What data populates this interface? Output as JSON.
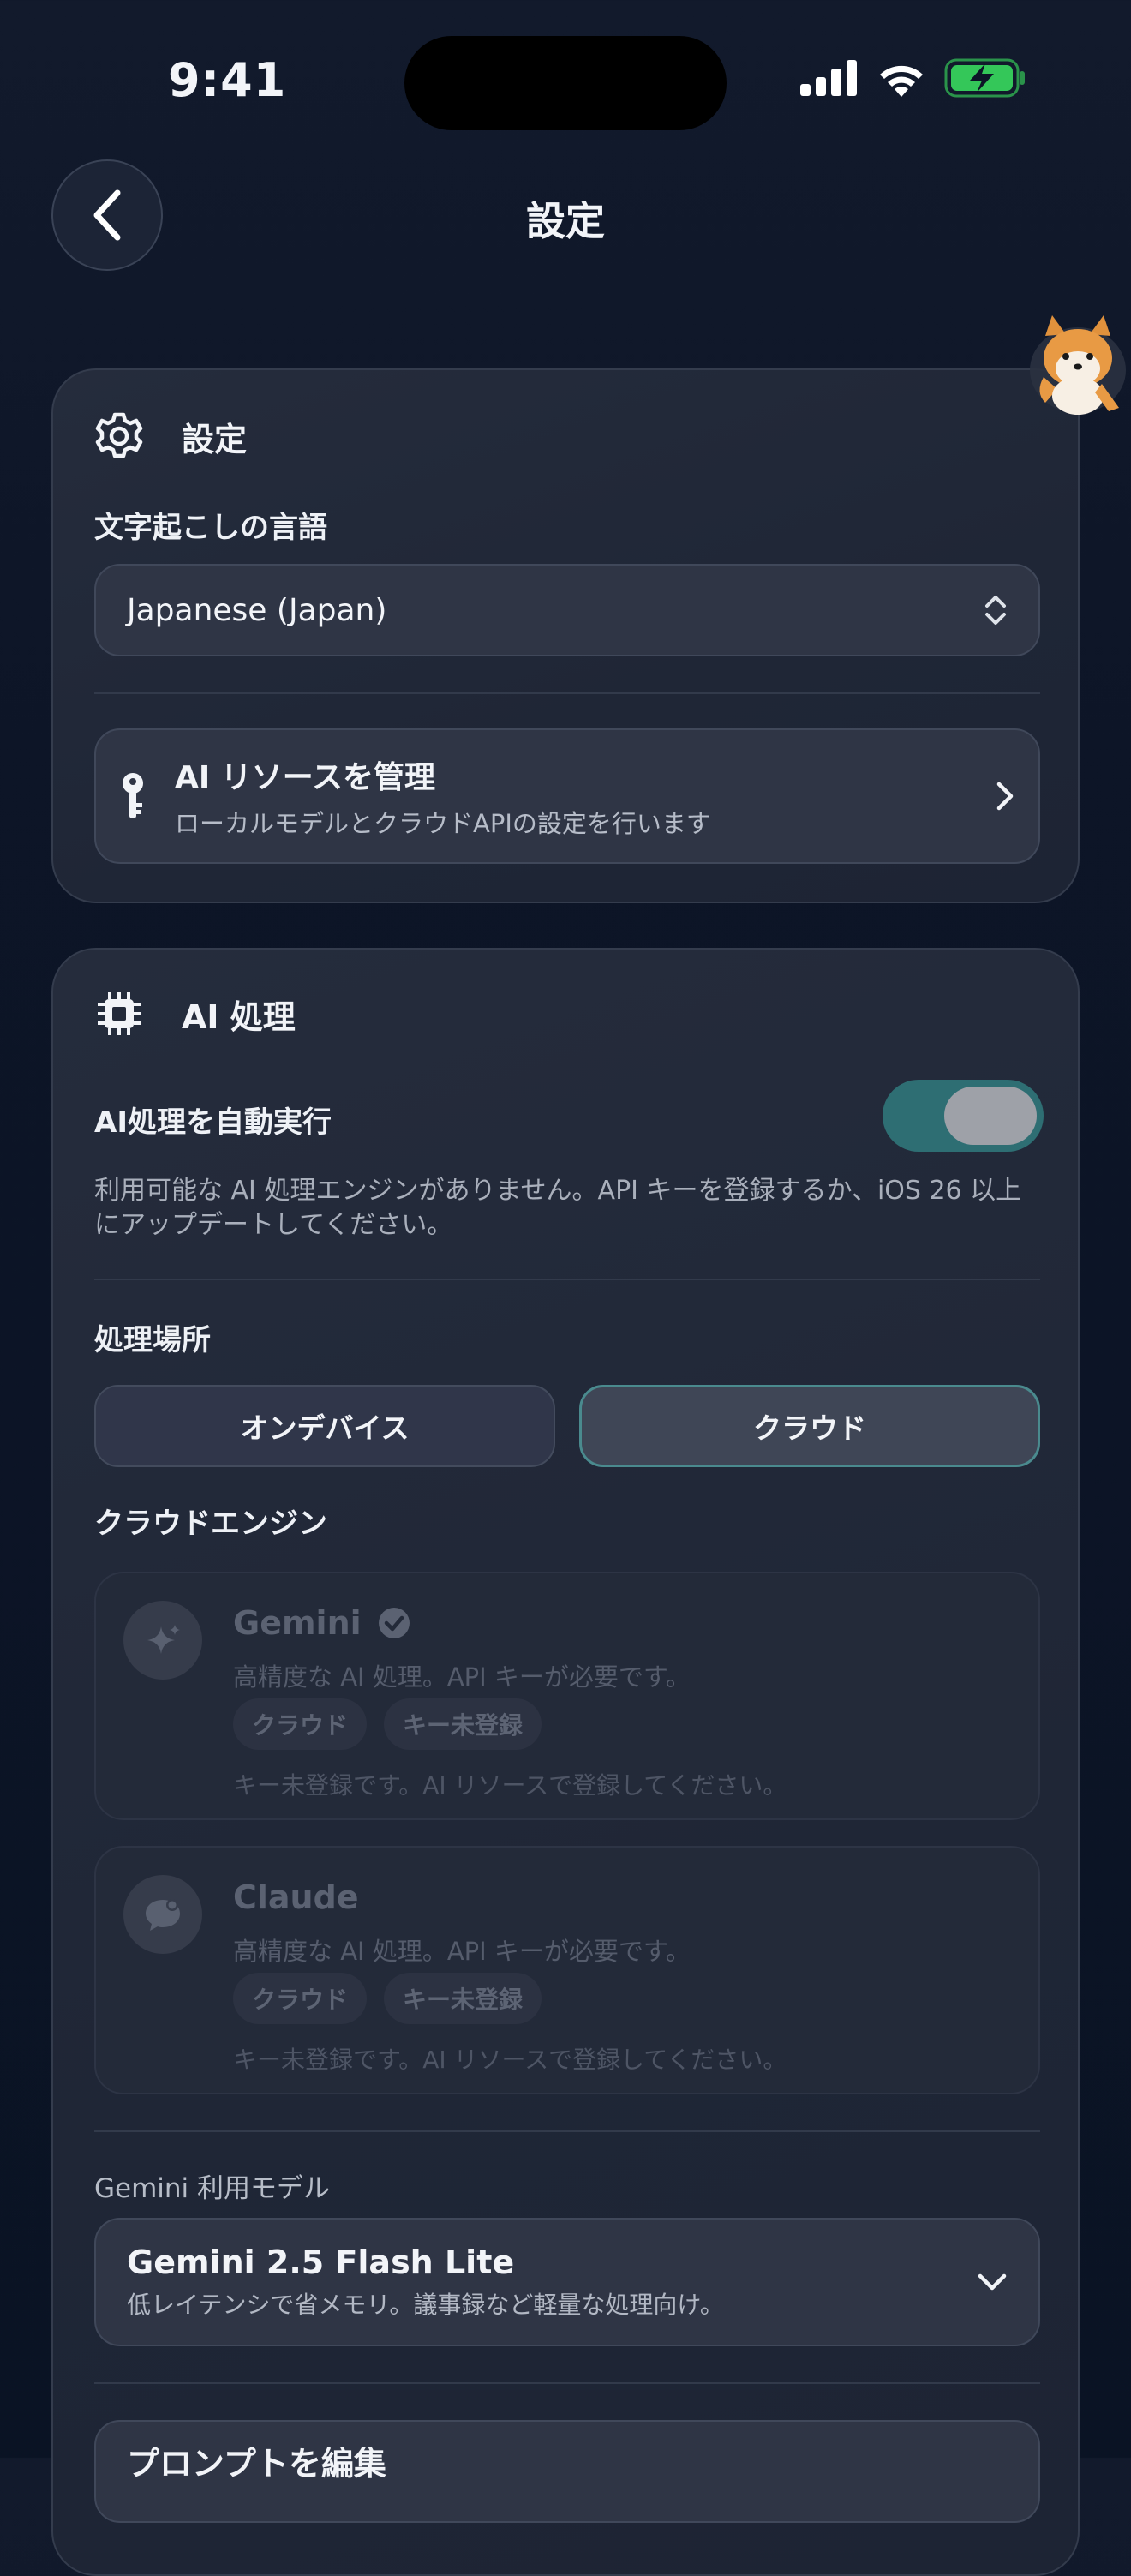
{
  "status": {
    "time": "9:41"
  },
  "nav": {
    "title": "設定"
  },
  "settings_card": {
    "header": "設定",
    "language_label": "文字起こしの言語",
    "language_value": "Japanese (Japan)",
    "ai_resources_title": "AI リソースを管理",
    "ai_resources_subtitle": "ローカルモデルとクラウドAPIの設定を行います"
  },
  "ai_card": {
    "header": "AI 処理",
    "auto_run_label": "AI処理を自動実行",
    "auto_run_enabled": true,
    "description": "利用可能な AI 処理エンジンがありません。API キーを登録するか、iOS 26 以上にアップデートしてください。",
    "location_label": "処理場所",
    "location_options": [
      "オンデバイス",
      "クラウド"
    ],
    "location_selected": "クラウド",
    "cloud_engine_label": "クラウドエンジン",
    "engines": [
      {
        "name": "Gemini",
        "description": "高精度な AI 処理。API キーが必要です。",
        "chips": [
          "クラウド",
          "キー未登録"
        ],
        "note": "キー未登録です。AI リソースで登録してください。",
        "icon": "sparkle-icon",
        "selected": true
      },
      {
        "name": "Claude",
        "description": "高精度な AI 処理。API キーが必要です。",
        "chips": [
          "クラウド",
          "キー未登録"
        ],
        "note": "キー未登録です。AI リソースで登録してください。",
        "icon": "chat-bubble-icon",
        "selected": false
      }
    ],
    "model_label": "Gemini 利用モデル",
    "model_value": "Gemini 2.5 Flash Lite",
    "model_description": "低レイテンシで省メモリ。議事録など軽量な処理向け。",
    "prompt_edit_label": "プロンプトを編集"
  },
  "colors": {
    "accent_teal": "#2e6e73",
    "battery_green": "#34c759",
    "background": "#0d1527"
  }
}
